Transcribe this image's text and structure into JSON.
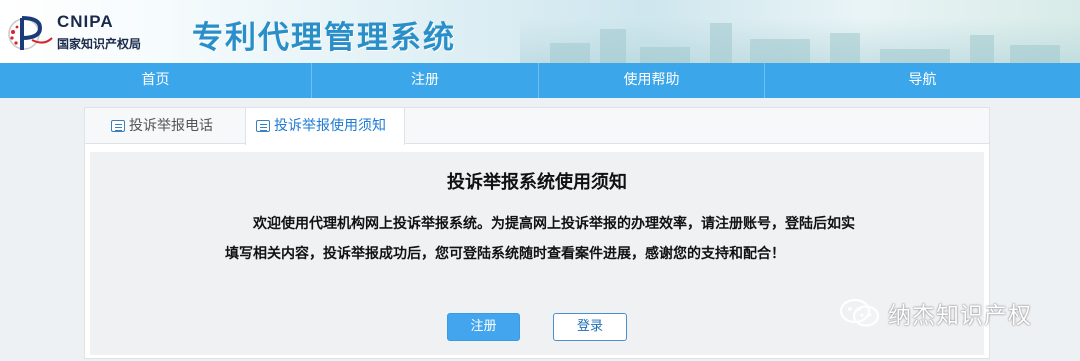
{
  "header": {
    "logo_en": "CNIPA",
    "logo_zh": "国家知识产权局",
    "system_title": "专利代理管理系统"
  },
  "nav": {
    "items": [
      {
        "label": "首页"
      },
      {
        "label": "注册"
      },
      {
        "label": "使用帮助"
      },
      {
        "label": "导航"
      }
    ]
  },
  "tabs": [
    {
      "label": "投诉举报电话",
      "active": false
    },
    {
      "label": "投诉举报使用须知",
      "active": true
    }
  ],
  "notice": {
    "title": "投诉举报系统使用须知",
    "body": "欢迎使用代理机构网上投诉举报系统。为提高网上投诉举报的办理效率，请注册账号，登陆后如实填写相关内容，投诉举报成功后，您可登陆系统随时查看案件进展，感谢您的支持和配合！"
  },
  "buttons": {
    "register": "注册",
    "login": "登录"
  },
  "watermark": {
    "text": "纳杰知识产权"
  },
  "colors": {
    "nav_bg": "#3ba7ea",
    "title_blue": "#2a8fc9",
    "active_tab": "#1f7bd4",
    "primary_button": "#42a5ee"
  }
}
